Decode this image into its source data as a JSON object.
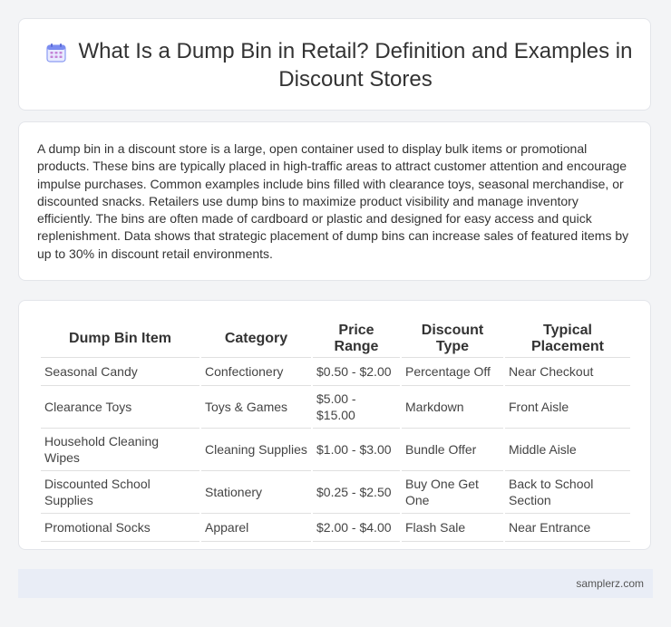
{
  "header": {
    "title": "What Is a Dump Bin in Retail? Definition and Examples in Discount Stores",
    "icon": "calendar-icon"
  },
  "intro": {
    "text": "A dump bin in a discount store is a large, open container used to display bulk items or promotional products. These bins are typically placed in high-traffic areas to attract customer attention and encourage impulse purchases. Common examples include bins filled with clearance toys, seasonal merchandise, or discounted snacks. Retailers use dump bins to maximize product visibility and manage inventory efficiently. The bins are often made of cardboard or plastic and designed for easy access and quick replenishment. Data shows that strategic placement of dump bins can increase sales of featured items by up to 30% in discount retail environments."
  },
  "table": {
    "headers": [
      "Dump Bin Item",
      "Category",
      "Price Range",
      "Discount Type",
      "Typical Placement"
    ],
    "rows": [
      [
        "Seasonal Candy",
        "Confectionery",
        "$0.50 - $2.00",
        "Percentage Off",
        "Near Checkout"
      ],
      [
        "Clearance Toys",
        "Toys & Games",
        "$5.00 - $15.00",
        "Markdown",
        "Front Aisle"
      ],
      [
        "Household Cleaning Wipes",
        "Cleaning Supplies",
        "$1.00 - $3.00",
        "Bundle Offer",
        "Middle Aisle"
      ],
      [
        "Discounted School Supplies",
        "Stationery",
        "$0.25 - $2.50",
        "Buy One Get One",
        "Back to School Section"
      ],
      [
        "Promotional Socks",
        "Apparel",
        "$2.00 - $4.00",
        "Flash Sale",
        "Near Entrance"
      ]
    ]
  },
  "footer": {
    "site": "samplerz.com"
  },
  "colors": {
    "background": "#f3f4f6",
    "card": "#ffffff",
    "footer": "#e9edf6",
    "icon_accent": "#7b8cf0"
  }
}
